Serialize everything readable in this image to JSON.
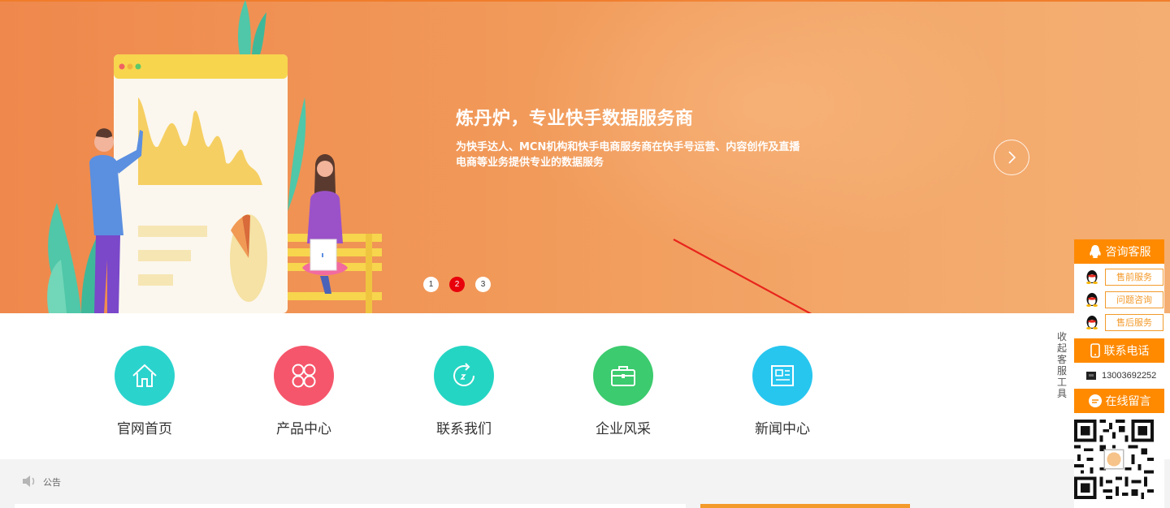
{
  "banner": {
    "title": "炼丹炉，专业快手数据服务商",
    "description": "为快手达人、MCN机构和快手电商服务商在快手号运营、内容创作及直播电商等业务提供专业的数据服务",
    "dots": [
      "1",
      "2",
      "3"
    ],
    "active_dot": 2
  },
  "nav": {
    "items": [
      {
        "label": "官网首页",
        "icon": "home-icon",
        "color": "#2bd3cd"
      },
      {
        "label": "产品中心",
        "icon": "grid-icon",
        "color": "#f5566b"
      },
      {
        "label": "联系我们",
        "icon": "refresh-icon",
        "color": "#25d5c3"
      },
      {
        "label": "企业风采",
        "icon": "briefcase-icon",
        "color": "#3ccb6e"
      },
      {
        "label": "新闻中心",
        "icon": "news-icon",
        "color": "#27c6ef"
      }
    ]
  },
  "notice": {
    "label": "公告",
    "icon": "speaker-icon"
  },
  "sidebar": {
    "collapse_label": "收起客服工具",
    "consult_title": "咨询客服",
    "qq_buttons": [
      "售前服务",
      "问题咨询",
      "售后服务"
    ],
    "phone_title": "联系电话",
    "phone_number": "13003692252",
    "message_title": "在线留言",
    "accent": "#ff8a00"
  }
}
